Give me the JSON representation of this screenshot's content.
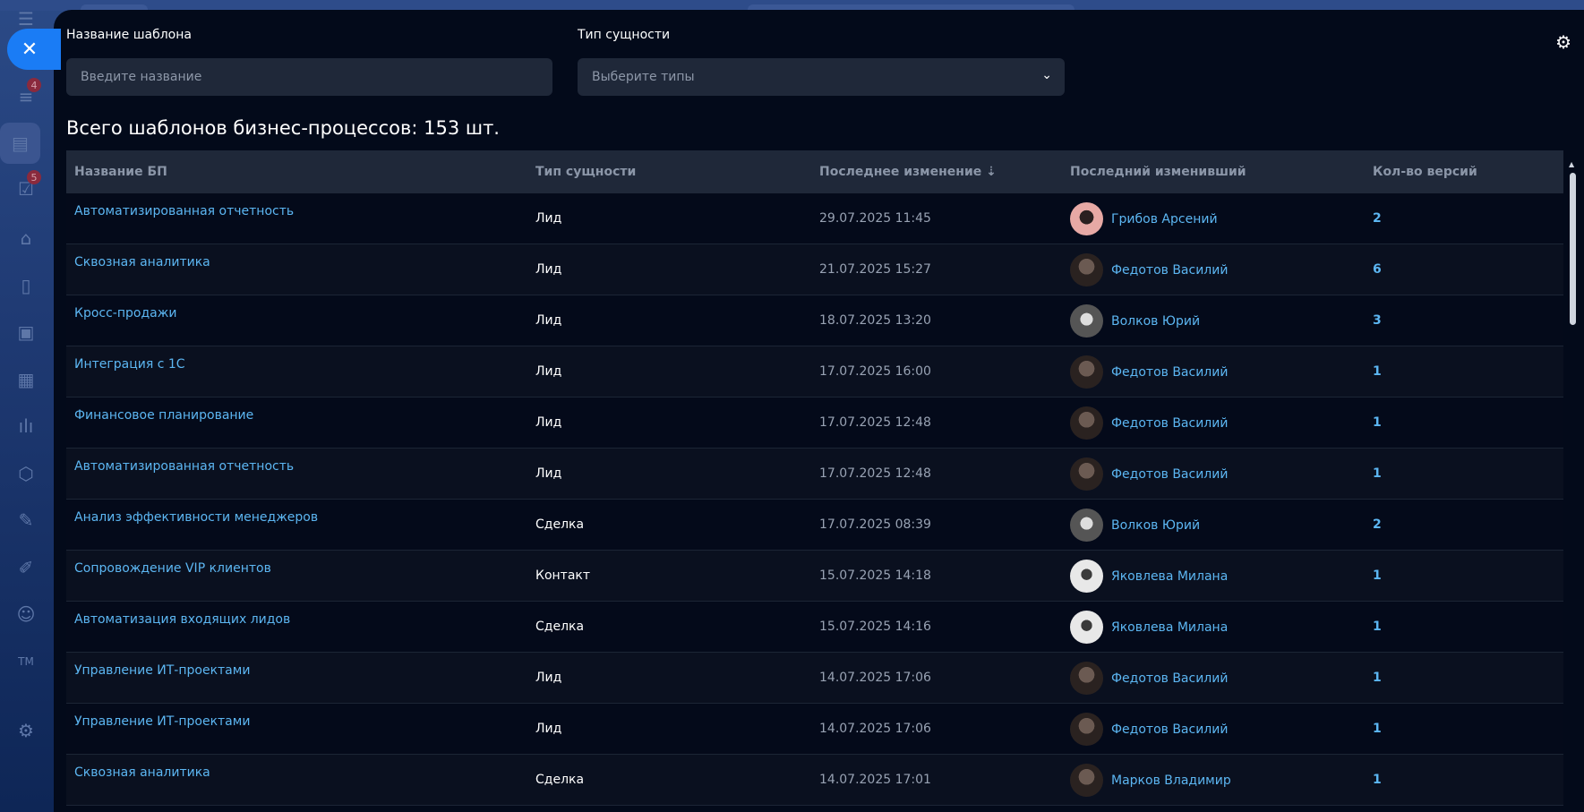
{
  "sidebar": {
    "badges": {
      "funnel": "4",
      "tasks": "5",
      "top": "4"
    },
    "tm_label": "TM"
  },
  "filters": {
    "name_label": "Название шаблона",
    "name_placeholder": "Введите название",
    "type_label": "Тип сущности",
    "type_placeholder": "Выберите типы"
  },
  "total": "Всего шаблонов бизнес-процессов: 153 шт.",
  "table": {
    "headers": {
      "name": "Название БП",
      "type": "Тип сущности",
      "modified": "Последнее изменение",
      "modifier": "Последний изменивший",
      "versions": "Кол-во версий"
    },
    "rows": [
      {
        "name": "Автоматизированная отчетность",
        "type": "Лид",
        "date": "29.07.2025 11:45",
        "user": "Грибов Арсений",
        "versions": "2"
      },
      {
        "name": "Сквозная аналитика",
        "type": "Лид",
        "date": "21.07.2025 15:27",
        "user": "Федотов Василий",
        "versions": "6"
      },
      {
        "name": "Кросс-продажи",
        "type": "Лид",
        "date": "18.07.2025 13:20",
        "user": "Волков Юрий",
        "versions": "3"
      },
      {
        "name": "Интеграция с 1С",
        "type": "Лид",
        "date": "17.07.2025 16:00",
        "user": "Федотов Василий",
        "versions": "1"
      },
      {
        "name": "Финансовое планирование",
        "type": "Лид",
        "date": "17.07.2025 12:48",
        "user": "Федотов Василий",
        "versions": "1"
      },
      {
        "name": "Автоматизированная отчетность",
        "type": "Лид",
        "date": "17.07.2025 12:48",
        "user": "Федотов Василий",
        "versions": "1"
      },
      {
        "name": "Анализ эффективности менеджеров",
        "type": "Сделка",
        "date": "17.07.2025 08:39",
        "user": "Волков Юрий",
        "versions": "2"
      },
      {
        "name": "Сопровождение VIP клиентов",
        "type": "Контакт",
        "date": "15.07.2025 14:18",
        "user": "Яковлева Милана",
        "versions": "1"
      },
      {
        "name": "Автоматизация входящих лидов",
        "type": "Сделка",
        "date": "15.07.2025 14:16",
        "user": "Яковлева Милана",
        "versions": "1"
      },
      {
        "name": "Управление ИТ-проектами",
        "type": "Лид",
        "date": "14.07.2025 17:06",
        "user": "Федотов Василий",
        "versions": "1"
      },
      {
        "name": "Управление ИТ-проектами",
        "type": "Лид",
        "date": "14.07.2025 17:06",
        "user": "Федотов Василий",
        "versions": "1"
      },
      {
        "name": "Сквозная аналитика",
        "type": "Сделка",
        "date": "14.07.2025 17:01",
        "user": "Марков Владимир",
        "versions": "1"
      }
    ]
  }
}
